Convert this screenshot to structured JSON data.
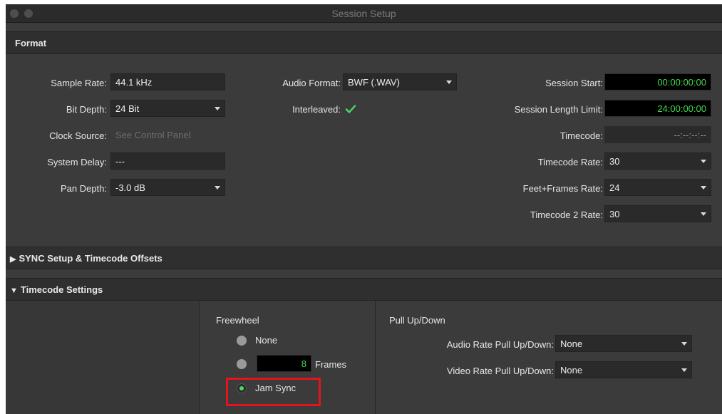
{
  "window": {
    "title": "Session Setup"
  },
  "format": {
    "header": "Format",
    "sample_rate": {
      "label": "Sample Rate:",
      "value": "44.1 kHz"
    },
    "bit_depth": {
      "label": "Bit Depth:",
      "value": "24 Bit"
    },
    "clock_source": {
      "label": "Clock Source:",
      "value": "See Control Panel"
    },
    "system_delay": {
      "label": "System Delay:",
      "value": "---"
    },
    "pan_depth": {
      "label": "Pan Depth:",
      "value": "-3.0 dB"
    },
    "audio_format": {
      "label": "Audio Format:",
      "value": "BWF (.WAV)"
    },
    "interleaved": {
      "label": "Interleaved:",
      "checked": true
    },
    "session_start": {
      "label": "Session Start:",
      "value": "00:00:00:00"
    },
    "session_length_limit": {
      "label": "Session Length Limit:",
      "value": "24:00:00:00"
    },
    "timecode": {
      "label": "Timecode:",
      "value": "--:--:--:--"
    },
    "timecode_rate": {
      "label": "Timecode Rate:",
      "value": "30"
    },
    "feet_frames_rate": {
      "label": "Feet+Frames Rate:",
      "value": "24"
    },
    "timecode2_rate": {
      "label": "Timecode 2 Rate:",
      "value": "30"
    }
  },
  "sync": {
    "header": "SYNC Setup & Timecode Offsets",
    "expanded": false
  },
  "timecode_settings": {
    "header": "Timecode Settings",
    "expanded": true,
    "freewheel": {
      "label": "Freewheel",
      "options": {
        "none": "None",
        "frames_value": "8",
        "frames_label": "Frames",
        "jam_sync": "Jam Sync"
      },
      "selected": "jam_sync"
    },
    "pull": {
      "label": "Pull Up/Down",
      "audio": {
        "label": "Audio Rate Pull Up/Down:",
        "value": "None"
      },
      "video": {
        "label": "Video Rate Pull Up/Down:",
        "value": "None"
      }
    }
  },
  "colors": {
    "timecode_green": "#3fdc4a",
    "highlight_red": "#e3141c",
    "radio_active": "#4cd964"
  }
}
